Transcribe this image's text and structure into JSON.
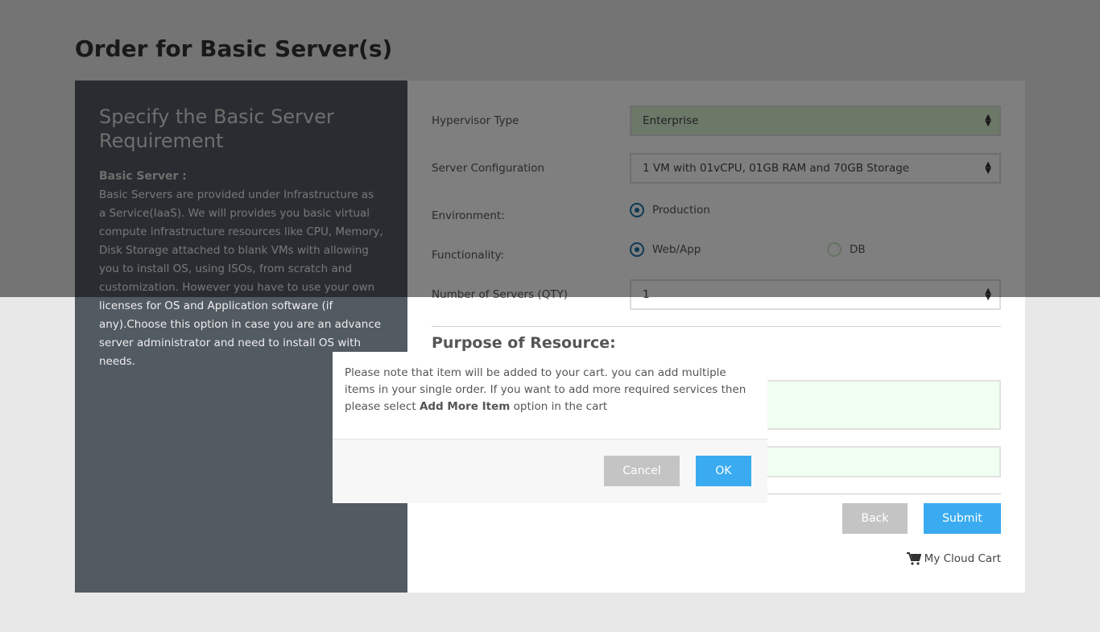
{
  "page_title": "Order for Basic Server(s)",
  "info": {
    "heading": "Specify the Basic Server Requirement",
    "subheading": "Basic Server :",
    "text": "Basic Servers are provided under Infrastructure as a Service(IaaS). We will provides you basic virtual compute infrastructure resources like CPU, Memory, Disk Storage attached to blank VMs with allowing you to install OS, using ISOs, from scratch and customization. However you have to use your own licenses for OS and Application software (if any).Choose this option in case you are an advance server administrator and need to install OS with needs."
  },
  "form": {
    "hypervisor": {
      "label": "Hypervisor Type",
      "value": "Enterprise"
    },
    "config": {
      "label": "Server Configuration",
      "value": "1 VM with 01vCPU, 01GB RAM and 70GB Storage"
    },
    "environment": {
      "label": "Environment:",
      "options": [
        {
          "label": "Production",
          "checked": true
        }
      ]
    },
    "functionality": {
      "label": "Functionality:",
      "options": [
        {
          "label": "Web/App",
          "checked": true
        },
        {
          "label": "DB",
          "checked": false
        }
      ]
    },
    "qty": {
      "label": "Number of Servers (QTY)",
      "value": "1"
    },
    "purpose_heading": "Purpose of Resource:",
    "back": "Back",
    "submit": "Submit",
    "cart": "My Cloud Cart"
  },
  "dialog": {
    "text_1": "Please note that item will be added to your cart. you can add multiple items in your single order. If you want to add more required services then please select ",
    "bold": "Add More Item",
    "text_2": " option in the cart",
    "cancel": "Cancel",
    "ok": "OK"
  },
  "colors": {
    "primary": "#3aabf0",
    "secondary": "#c4c4c4",
    "panel": "#525a62"
  }
}
